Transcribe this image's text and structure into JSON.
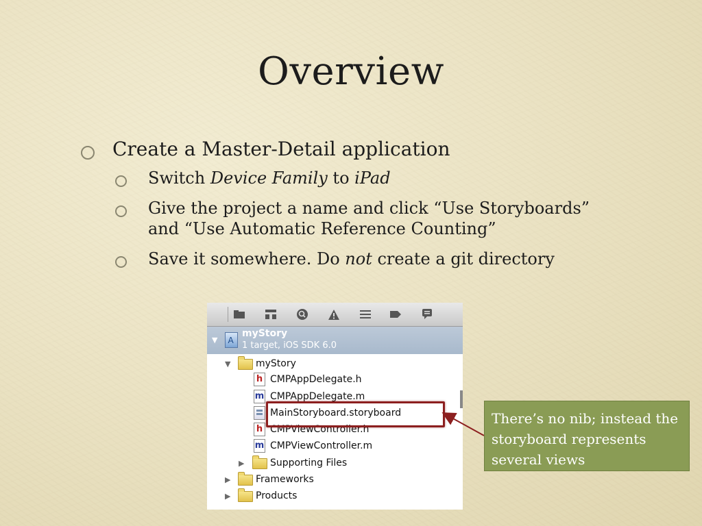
{
  "title": "Overview",
  "bullets": {
    "b1": "Create a Master-Detail application",
    "b2a": {
      "pre": "Switch ",
      "em1": "Device Family",
      "mid": " to ",
      "em2": "iPad"
    },
    "b2b_line1": "Give the project a name and click “Use Storyboards”",
    "b2b_line2": "and “Use Automatic Reference Counting”",
    "b2c": {
      "pre": "Save it somewhere.  Do ",
      "em": "not",
      "post": " create a git directory"
    }
  },
  "navigator": {
    "toolbar_icons": [
      "folder-icon",
      "hierarchy-icon",
      "search-icon",
      "warning-icon",
      "list-icon",
      "tag-icon",
      "comment-icon"
    ],
    "project": {
      "name": "myStory",
      "subtitle": "1 target, iOS SDK 6.0"
    },
    "group": "myStory",
    "files": [
      {
        "type": "h",
        "name": "CMPAppDelegate.h"
      },
      {
        "type": "m",
        "name": "CMPAppDelegate.m"
      },
      {
        "type": "sb",
        "name": "MainStoryboard.storyboard"
      },
      {
        "type": "h",
        "name": "CMPViewController.h"
      },
      {
        "type": "m",
        "name": "CMPViewController.m"
      }
    ],
    "subgroup": "Supporting Files",
    "folders": [
      "Frameworks",
      "Products"
    ]
  },
  "callout": "There’s no nib; instead the storyboard represents several views",
  "colors": {
    "callout_bg": "#8a9c55",
    "highlight": "#8c1f1f",
    "selection": "#a8b9cc"
  }
}
